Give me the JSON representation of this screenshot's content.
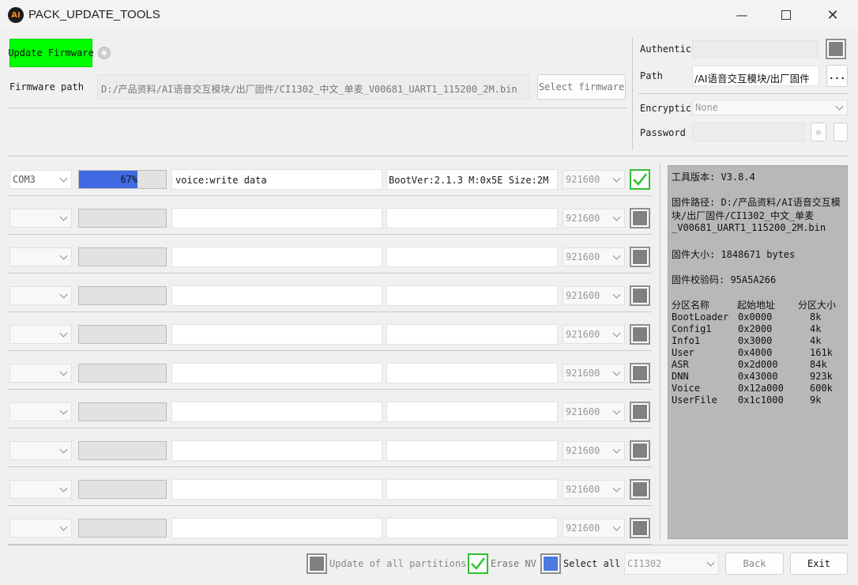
{
  "window": {
    "title": "PACK_UPDATE_TOOLS",
    "icon_text": "AI",
    "controls": [
      "minimize-icon",
      "maximize-icon",
      "close-icon"
    ]
  },
  "firmware": {
    "update_button": "Update Firmware",
    "update_button_color": "#00ff00",
    "path_label": "Firmware path",
    "path_value": "D:/产品资料/AI语音交互模块/出厂固件/CI1302_中文_单麦_V00681_UART1_115200_2M.bin",
    "select_button": "Select firmware"
  },
  "auth": {
    "authentic_label": "Authentic",
    "path_label": "Path",
    "path_value": "/AI语音交互模块/出厂固件",
    "browse_button": "...",
    "encryption_label": "Encryptic",
    "encryption_value": "None",
    "password_label": "Password",
    "password_value": ""
  },
  "ports": [
    {
      "port": "COM3",
      "progress_text": "67%",
      "progress": 0.67,
      "status": "voice:write data",
      "info": "BootVer:2.1.3 M:0x5E Size:2M",
      "baud": "921600",
      "checked": true
    },
    {
      "port": "",
      "progress_text": "",
      "progress": 0,
      "status": "",
      "info": "",
      "baud": "921600",
      "checked": false
    },
    {
      "port": "",
      "progress_text": "",
      "progress": 0,
      "status": "",
      "info": "",
      "baud": "921600",
      "checked": false
    },
    {
      "port": "",
      "progress_text": "",
      "progress": 0,
      "status": "",
      "info": "",
      "baud": "921600",
      "checked": false
    },
    {
      "port": "",
      "progress_text": "",
      "progress": 0,
      "status": "",
      "info": "",
      "baud": "921600",
      "checked": false
    },
    {
      "port": "",
      "progress_text": "",
      "progress": 0,
      "status": "",
      "info": "",
      "baud": "921600",
      "checked": false
    },
    {
      "port": "",
      "progress_text": "",
      "progress": 0,
      "status": "",
      "info": "",
      "baud": "921600",
      "checked": false
    },
    {
      "port": "",
      "progress_text": "",
      "progress": 0,
      "status": "",
      "info": "",
      "baud": "921600",
      "checked": false
    },
    {
      "port": "",
      "progress_text": "",
      "progress": 0,
      "status": "",
      "info": "",
      "baud": "921600",
      "checked": false
    },
    {
      "port": "",
      "progress_text": "",
      "progress": 0,
      "status": "",
      "info": "",
      "baud": "921600",
      "checked": false
    }
  ],
  "info_panel": {
    "tool_version": "工具版本: V3.8.4",
    "firmware_path_lines": [
      "固件路径: D:/产品资料/AI语音交互模",
      "块/出厂固件/CI1302_中文_单麦",
      "_V00681_UART1_115200_2M.bin"
    ],
    "firmware_size": "固件大小: 1848671 bytes",
    "checksum": "固件校验码: 95A5A266",
    "partition_headers": [
      "分区名称",
      "起始地址",
      "分区大小"
    ],
    "partitions": [
      {
        "name": "BootLoader",
        "addr": "0x0000",
        "size": "8k"
      },
      {
        "name": "Config1",
        "addr": "0x2000",
        "size": "4k"
      },
      {
        "name": "Info1",
        "addr": "0x3000",
        "size": "4k"
      },
      {
        "name": "User",
        "addr": "0x4000",
        "size": "161k"
      },
      {
        "name": "ASR",
        "addr": "0x2d000",
        "size": "84k"
      },
      {
        "name": "DNN",
        "addr": "0x43000",
        "size": "923k"
      },
      {
        "name": "Voice",
        "addr": "0x12a000",
        "size": "600k"
      },
      {
        "name": "UserFile",
        "addr": "0x1c1000",
        "size": "9k"
      }
    ]
  },
  "footer": {
    "update_all_label": "Update of all partitions",
    "update_all_checked": false,
    "erase_nv_label": "Erase NV",
    "erase_nv_checked": true,
    "select_all_label": "Select all",
    "select_all_color": "#4b7be0",
    "chip_value": "CI1302",
    "back_button": "Back",
    "exit_button": "Exit"
  },
  "colors": {
    "progress_fill": "#4169e1",
    "check_on": "#2fc02f",
    "info_bg": "#b8b8b8"
  }
}
